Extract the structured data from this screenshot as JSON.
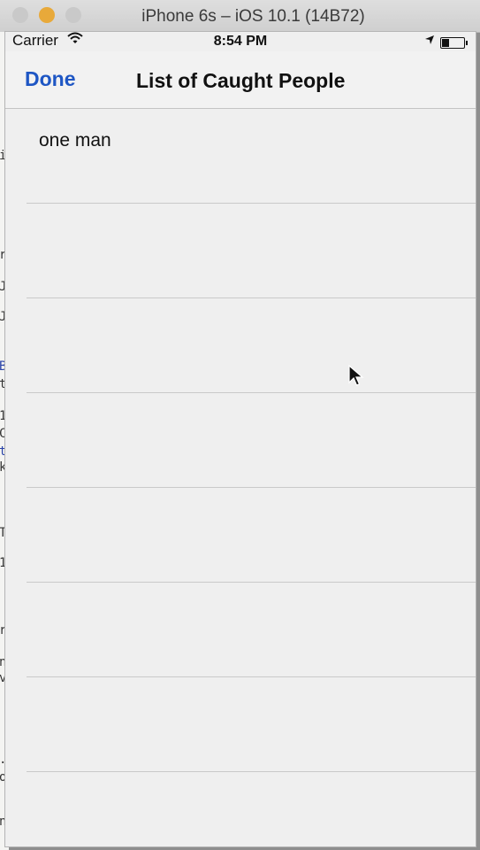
{
  "window": {
    "title": "iPhone 6s – iOS 10.1 (14B72)"
  },
  "status_bar": {
    "carrier": "Carrier",
    "time": "8:54 PM"
  },
  "nav_bar": {
    "done_label": "Done",
    "title": "List of Caught People"
  },
  "table": {
    "rows": [
      {
        "label": "one man"
      },
      {
        "label": ""
      },
      {
        "label": ""
      },
      {
        "label": ""
      },
      {
        "label": ""
      },
      {
        "label": ""
      },
      {
        "label": ""
      },
      {
        "label": ""
      }
    ]
  },
  "background_code_chars": [
    "i",
    "r",
    "J",
    "J",
    "B",
    "t",
    "1",
    "C",
    "t",
    "k",
    "T",
    "1",
    "r",
    "na",
    "vi",
    ".",
    "of",
    "no"
  ],
  "colors": {
    "tint": "#1e56c4",
    "separator": "#c9c9c9",
    "screen_bg": "#efefef"
  }
}
